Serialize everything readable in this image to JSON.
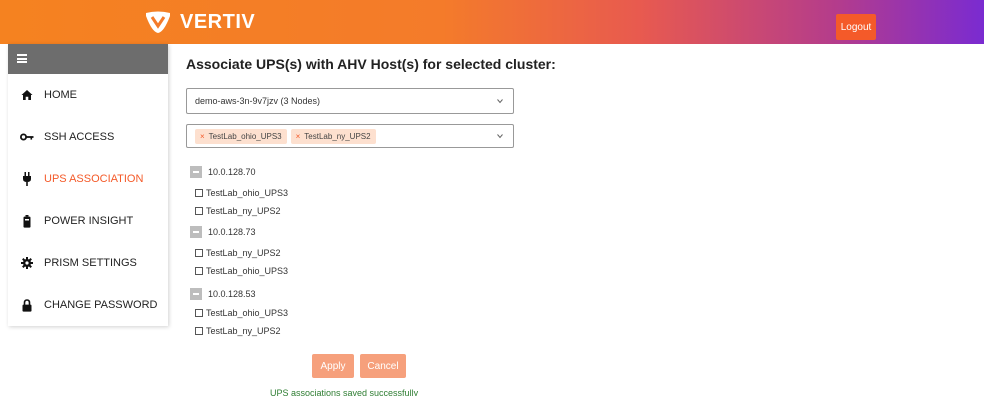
{
  "header": {
    "brand": "VERTIV",
    "logout_label": "Logout",
    "gradient_colors": [
      "#f58220",
      "#e85a4f",
      "#7a2bd1"
    ]
  },
  "sidebar": {
    "items": [
      {
        "label": "HOME",
        "icon": "home-icon"
      },
      {
        "label": "SSH ACCESS",
        "icon": "key-icon"
      },
      {
        "label": "UPS ASSOCIATION",
        "icon": "plug-icon",
        "active": true
      },
      {
        "label": "POWER INSIGHT",
        "icon": "battery-icon"
      },
      {
        "label": "PRISM SETTINGS",
        "icon": "gear-icon"
      },
      {
        "label": "CHANGE PASSWORD",
        "icon": "lock-icon"
      }
    ],
    "active_color": "#f45a29"
  },
  "main": {
    "title": "Associate UPS(s) with AHV Host(s) for selected cluster:",
    "cluster_select": {
      "value": "demo-aws-3n-9v7jzv (3 Nodes)"
    },
    "ups_select": {
      "chips": [
        "TestLab_ohio_UPS3",
        "TestLab_ny_UPS2"
      ]
    },
    "hosts": [
      {
        "ip": "10.0.128.70",
        "ups": [
          "TestLab_ohio_UPS3",
          "TestLab_ny_UPS2"
        ]
      },
      {
        "ip": "10.0.128.73",
        "ups": [
          "TestLab_ny_UPS2",
          "TestLab_ohio_UPS3"
        ]
      },
      {
        "ip": "10.0.128.53",
        "ups": [
          "TestLab_ohio_UPS3",
          "TestLab_ny_UPS2"
        ]
      }
    ],
    "apply_label": "Apply",
    "cancel_label": "Cancel",
    "status": "UPS associations saved successfully"
  }
}
